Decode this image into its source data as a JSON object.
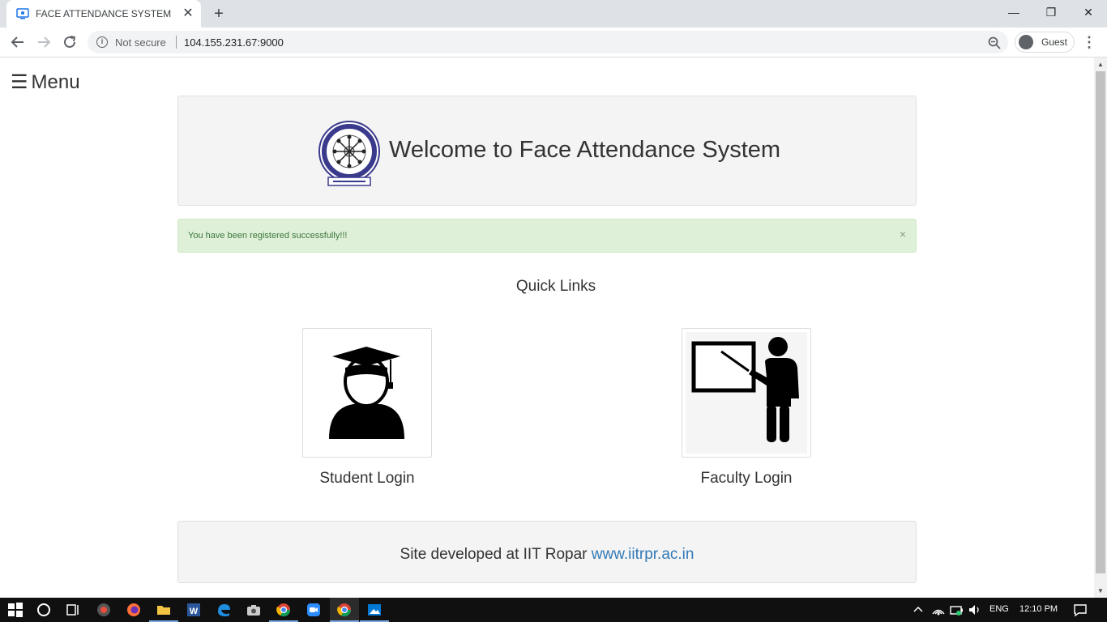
{
  "browser": {
    "tab_title": "FACE ATTENDANCE SYSTEM",
    "tab_close": "✕",
    "new_tab": "+",
    "not_secure": "Not secure",
    "url": "104.155.231.67:9000",
    "profile_label": "Guest",
    "window_controls": {
      "minimize": "—",
      "restore": "❐",
      "close": "✕"
    }
  },
  "page": {
    "menu_icon": "☰",
    "menu_label": "Menu",
    "welcome_title": "Welcome to Face Attendance System",
    "alert_message": "You have been registered successfully!!!",
    "alert_close": "×",
    "quick_links_heading": "Quick Links",
    "quick_links": [
      {
        "label": "Student Login",
        "icon": "graduate-icon"
      },
      {
        "label": "Faculty Login",
        "icon": "teacher-icon"
      }
    ],
    "footer_text": "Site developed at IIT Ropar ",
    "footer_link": "www.iitrpr.ac.in"
  },
  "taskbar": {
    "language": "ENG",
    "time": "12:10 PM"
  }
}
